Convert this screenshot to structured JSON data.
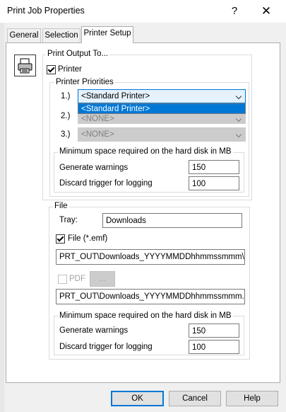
{
  "window": {
    "title": "Print Job Properties",
    "help_glyph": "?",
    "close_glyph": "✕"
  },
  "tabs": [
    {
      "label": "General"
    },
    {
      "label": "Selection"
    },
    {
      "label": "Printer Setup"
    }
  ],
  "output": {
    "group_label": "Print Output To...",
    "printer_checkbox_label": "Printer",
    "printer_checked": true,
    "priorities": {
      "group_label": "Printer Priorities",
      "rows": [
        {
          "label": "1.)",
          "value": "<Standard Printer>",
          "enabled": true
        },
        {
          "label": "2.)",
          "value": "<NONE>",
          "enabled": false
        },
        {
          "label": "3.)",
          "value": "<NONE>",
          "enabled": false
        }
      ],
      "dropdown_open_item": "<Standard Printer>"
    },
    "disk": {
      "group_label": "Minimum space required on the hard disk in MB",
      "warnings_label": "Generate warnings",
      "warnings_value": "150",
      "discard_label": "Discard trigger for logging",
      "discard_value": "100"
    }
  },
  "file": {
    "group_label": "File",
    "tray_label": "Tray:",
    "tray_value": "Downloads",
    "file_checkbox_label": "File  (*.emf)",
    "file_checked": true,
    "emf_path": "PRT_OUT\\Downloads_YYYYMMDDhhmmssmmm\\...",
    "pdf_checkbox_label": "PDF",
    "pdf_checked": false,
    "browse_label": "...",
    "pdf_path": "PRT_OUT\\Downloads_YYYYMMDDhhmmssmmm.pdf",
    "disk": {
      "group_label": "Minimum space required on the hard disk in MB",
      "warnings_label": "Generate warnings",
      "warnings_value": "150",
      "discard_label": "Discard trigger for logging",
      "discard_value": "100"
    }
  },
  "buttons": {
    "ok": "OK",
    "cancel": "Cancel",
    "help": "Help"
  },
  "icons": {
    "printer": "printer-icon"
  }
}
